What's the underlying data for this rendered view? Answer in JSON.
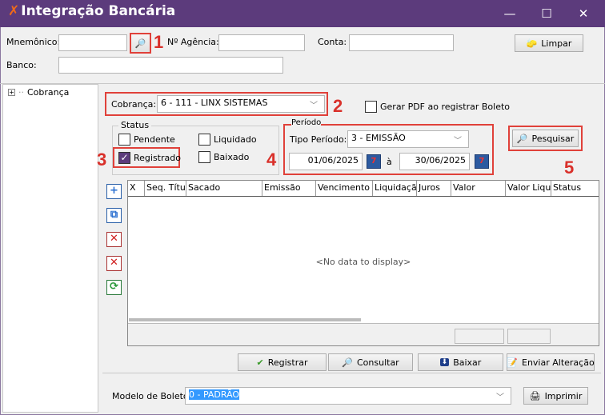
{
  "window": {
    "title": "Integração Bancária",
    "minimize": "—",
    "maximize": "☐",
    "close": "✕"
  },
  "filters": {
    "mnemonico_label": "Mnemônico:",
    "mnemonico_value": "",
    "agencia_label": "Nº Agência:",
    "agencia_value": "",
    "conta_label": "Conta:",
    "conta_value": "",
    "banco_label": "Banco:",
    "banco_value": "",
    "limpar": "Limpar"
  },
  "tree": {
    "items": [
      {
        "label": "Cobrança",
        "expander": "+"
      }
    ]
  },
  "cobranca": {
    "label": "Cobrança:",
    "value": "6 - 111 - LINX SISTEMAS",
    "gerar_pdf_label": "Gerar PDF ao registrar Boleto",
    "gerar_pdf_checked": false
  },
  "status": {
    "legend": "Status",
    "options": [
      {
        "label": "Pendente",
        "checked": false
      },
      {
        "label": "Liquidado",
        "checked": false
      },
      {
        "label": "Registrado",
        "checked": true
      },
      {
        "label": "Baixado",
        "checked": false
      }
    ]
  },
  "periodo": {
    "legend": "Período",
    "tipo_label": "Tipo Período:",
    "tipo_value": "3 - EMISSÃO",
    "from": "01/06/2025",
    "sep": "à",
    "to": "30/06/2025"
  },
  "pesquisar": "Pesquisar",
  "annotations": [
    "1",
    "2",
    "3",
    "4",
    "5"
  ],
  "grid": {
    "columns": [
      "X",
      "Seq. Títul",
      "Sacado",
      "Emissão",
      "Vencimento",
      "Liquidação",
      "Juros",
      "Valor",
      "Valor Liquic",
      "Status"
    ],
    "rows": [],
    "empty": "<No data to display>"
  },
  "actions": {
    "registrar": "Registrar",
    "consultar": "Consultar",
    "baixar": "Baixar",
    "enviar": "Enviar Alteração"
  },
  "modelo": {
    "label": "Modelo de Boleto:",
    "value": "0 - PADRÃO",
    "imprimir": "Imprimir"
  },
  "colors": {
    "titlebar": "#5c3b7c",
    "annotation": "#e0413a",
    "selection": "#3399ff"
  }
}
